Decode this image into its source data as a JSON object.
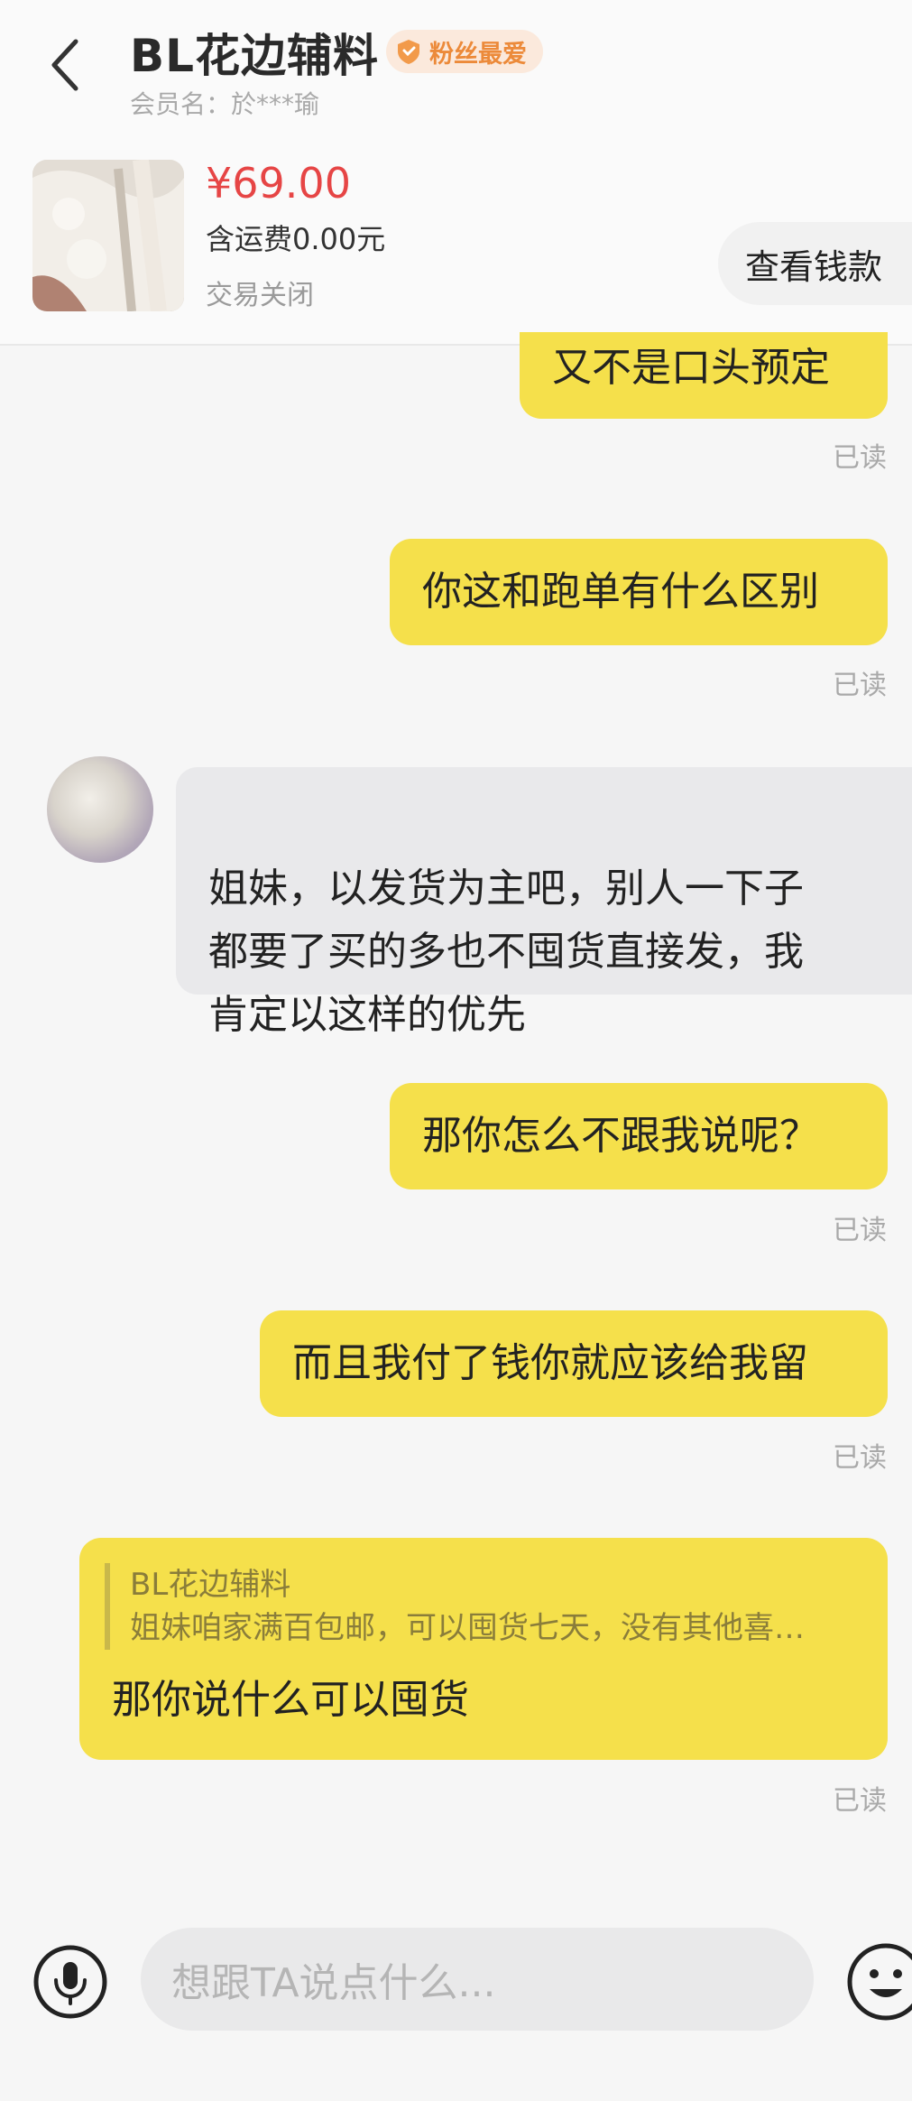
{
  "header": {
    "title": "BL花边辅料",
    "badge": "粉丝最爱",
    "member": "会员名：於***瑜"
  },
  "order": {
    "price": "¥69.00",
    "shipping": "含运费0.00元",
    "status": "交易关闭",
    "view_button": "查看钱款"
  },
  "messages": [
    {
      "text": "又不是口头预定",
      "read": "已读"
    },
    {
      "text": "你这和跑单有什么区别",
      "read": "已读"
    },
    {
      "text": "姐妹，以发货为主吧，别人一下子\n都要了买的多也不囤货直接发，我\n肯定以这样的优先"
    },
    {
      "text": "那你怎么不跟我说呢？",
      "read": "已读"
    },
    {
      "text": "而且我付了钱你就应该给我留",
      "read": "已读"
    },
    {
      "quote_name": "BL花边辅料",
      "quote_text": "姐妹咱家满百包邮，可以囤货七天，没有其他喜…",
      "text": "那你说什么可以囤货",
      "read": "已读"
    }
  ],
  "input": {
    "placeholder": "想跟TA说点什么..."
  },
  "icons": {
    "back": "chevron-left-icon",
    "badge": "shield-heart-icon",
    "mic": "microphone-icon",
    "emoji": "smiley-icon"
  },
  "colors": {
    "outgoing_bubble": "#f5e04b",
    "incoming_bubble": "#e9e9eb",
    "price": "#e64545",
    "badge_text": "#ec8a3a"
  }
}
